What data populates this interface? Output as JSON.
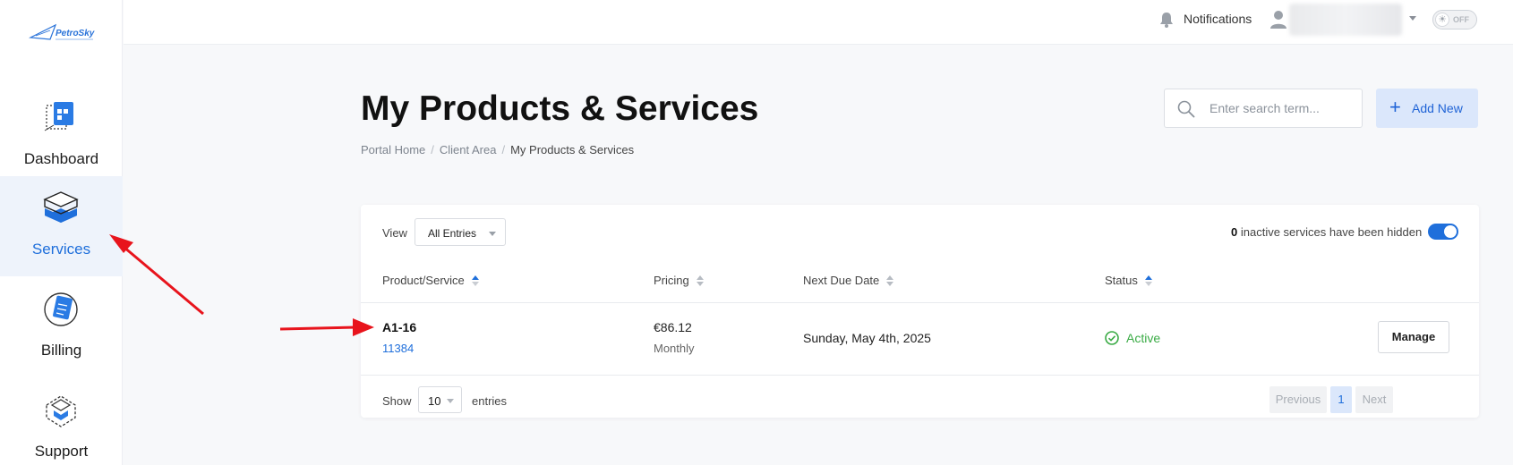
{
  "brand": {
    "logo_text": "PetroSky"
  },
  "sidebar": {
    "items": [
      {
        "label": "Dashboard",
        "icon": "dashboard-icon",
        "active": false
      },
      {
        "label": "Services",
        "icon": "services-icon",
        "active": true
      },
      {
        "label": "Billing",
        "icon": "billing-icon",
        "active": false
      },
      {
        "label": "Support",
        "icon": "support-icon",
        "active": false
      }
    ]
  },
  "topbar": {
    "notifications_label": "Notifications",
    "theme_toggle_label": "OFF"
  },
  "page": {
    "title": "My Products & Services",
    "breadcrumb": [
      "Portal Home",
      "Client Area",
      "My Products & Services"
    ]
  },
  "search": {
    "placeholder": "Enter search term..."
  },
  "actions": {
    "add_new_label": "Add New"
  },
  "table": {
    "view_label": "View",
    "view_value": "All Entries",
    "hidden_count": "0",
    "hidden_note": "inactive services have been hidden",
    "columns": [
      "Product/Service",
      "Pricing",
      "Next Due Date",
      "Status"
    ],
    "rows": [
      {
        "product": "A1-16",
        "id": "11384",
        "price": "€86.12",
        "cycle": "Monthly",
        "due": "Sunday, May 4th, 2025",
        "status": "Active",
        "action": "Manage"
      }
    ],
    "show_label": "Show",
    "page_length": "10",
    "entries_label": "entries",
    "pagination": {
      "previous": "Previous",
      "current": "1",
      "next": "Next"
    }
  },
  "colors": {
    "accent": "#1f6fdb",
    "active_status": "#3aab45",
    "annotation_arrow": "#e8141c"
  }
}
